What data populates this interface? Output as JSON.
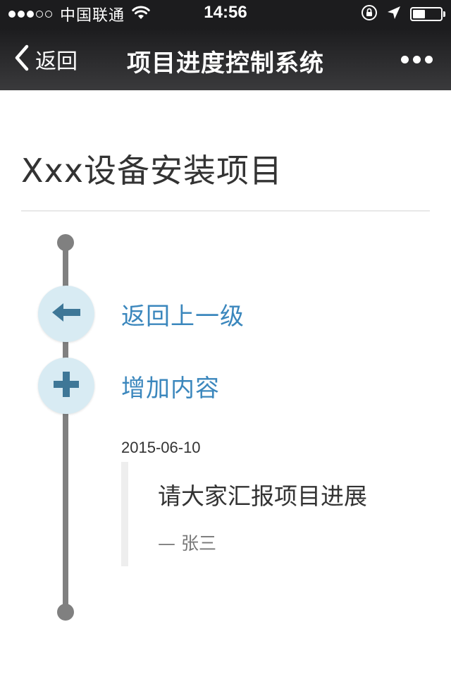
{
  "status_bar": {
    "signal": {
      "filled": 3,
      "total": 5
    },
    "carrier": "中国联通",
    "time": "14:56",
    "battery_level": 0.45,
    "icons": [
      "wifi-icon",
      "orientation-lock-icon",
      "location-arrow-icon",
      "battery-icon"
    ]
  },
  "nav": {
    "back_label": "返回",
    "title": "项目进度控制系统",
    "icons": [
      "chevron-left-icon",
      "more-icon"
    ]
  },
  "project": {
    "title": "Xxx设备安装项目"
  },
  "actions": [
    {
      "label": "返回上一级",
      "icon": "arrow-left-icon"
    },
    {
      "label": "增加内容",
      "icon": "plus-icon"
    }
  ],
  "post": {
    "date": "2015-06-10",
    "text": "请大家汇报项目进展",
    "author": "— 张三"
  },
  "colors": {
    "bar_bg": "#1c1c1e",
    "link": "#3b87bd",
    "circle_bg": "#d8ebf3",
    "icon": "#3e7797",
    "timeline": "#808080"
  }
}
